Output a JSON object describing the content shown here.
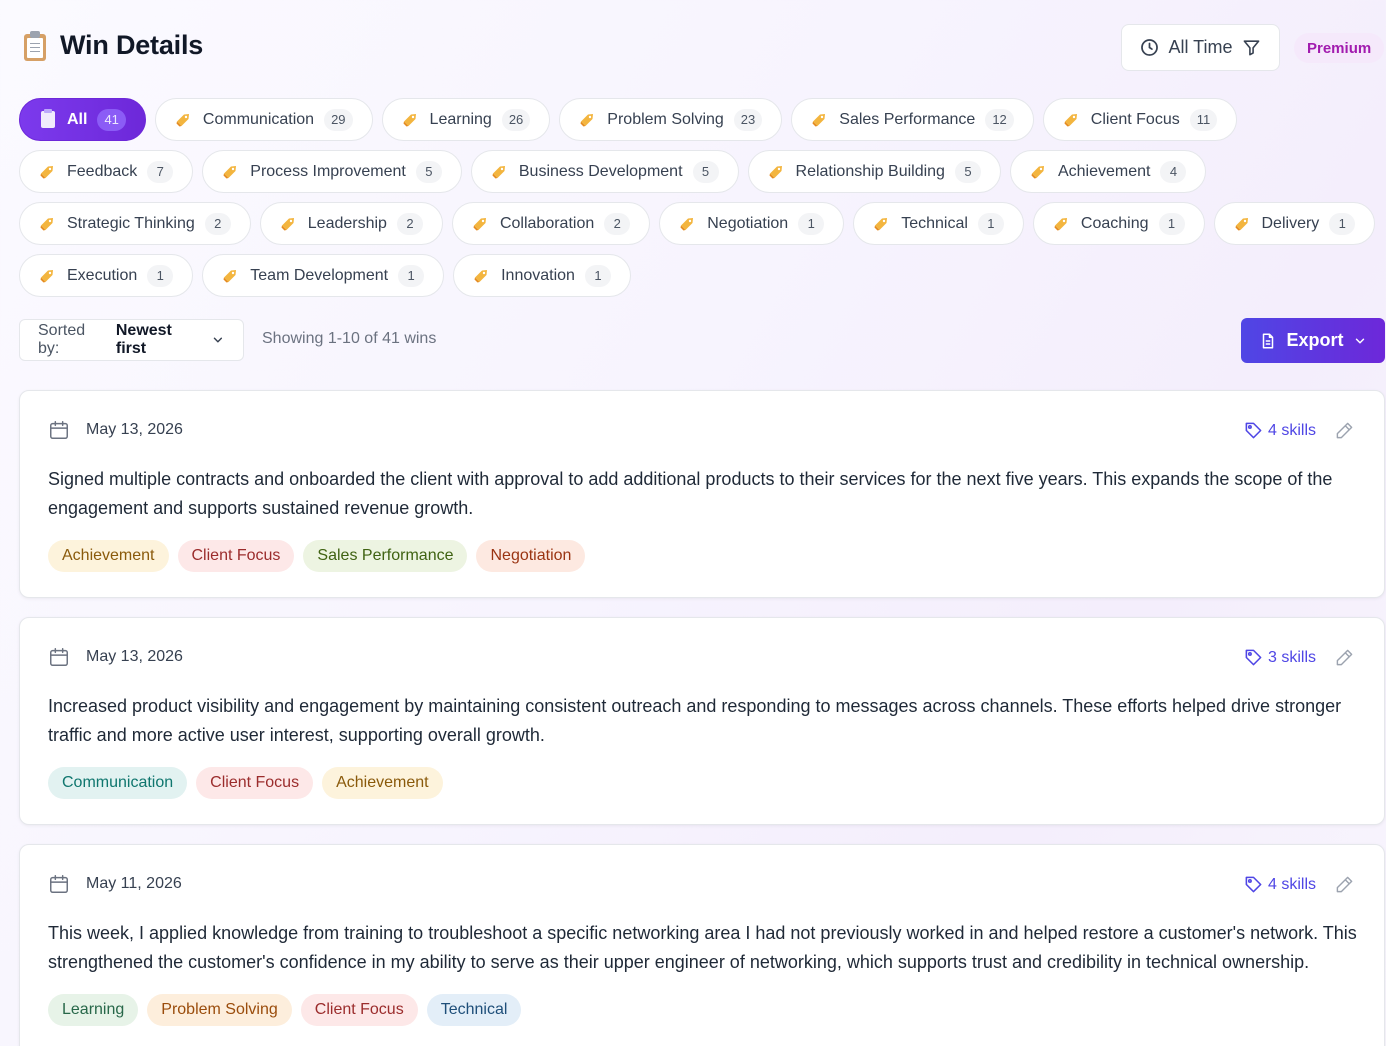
{
  "header": {
    "title": "Win Details",
    "time_filter": "All Time",
    "premium_badge": "Premium"
  },
  "categories": [
    {
      "label": "All",
      "count": "41",
      "active": true
    },
    {
      "label": "Communication",
      "count": "29"
    },
    {
      "label": "Learning",
      "count": "26"
    },
    {
      "label": "Problem Solving",
      "count": "23"
    },
    {
      "label": "Sales Performance",
      "count": "12"
    },
    {
      "label": "Client Focus",
      "count": "11"
    },
    {
      "label": "Feedback",
      "count": "7"
    },
    {
      "label": "Process Improvement",
      "count": "5"
    },
    {
      "label": "Business Development",
      "count": "5"
    },
    {
      "label": "Relationship Building",
      "count": "5"
    },
    {
      "label": "Achievement",
      "count": "4"
    },
    {
      "label": "Strategic Thinking",
      "count": "2"
    },
    {
      "label": "Leadership",
      "count": "2"
    },
    {
      "label": "Collaboration",
      "count": "2"
    },
    {
      "label": "Negotiation",
      "count": "1"
    },
    {
      "label": "Technical",
      "count": "1"
    },
    {
      "label": "Coaching",
      "count": "1"
    },
    {
      "label": "Delivery",
      "count": "1"
    },
    {
      "label": "Execution",
      "count": "1"
    },
    {
      "label": "Team Development",
      "count": "1"
    },
    {
      "label": "Innovation",
      "count": "1"
    }
  ],
  "toolbar": {
    "sort_prefix": "Sorted by:",
    "sort_value": "Newest first",
    "showing": "Showing 1-10 of 41 wins",
    "export_label": "Export"
  },
  "colors": {
    "accent": "#6d28d9",
    "export_start": "#4f46e5",
    "premium_text": "#a21caf"
  },
  "tag_styles": {
    "Achievement": {
      "bg": "#fdf3dc",
      "fg": "#8a5a0b"
    },
    "Client Focus": {
      "bg": "#fde8e8",
      "fg": "#9b2c2c"
    },
    "Sales Performance": {
      "bg": "#edf4e2",
      "fg": "#3f6212"
    },
    "Negotiation": {
      "bg": "#fde9e1",
      "fg": "#9a3412"
    },
    "Communication": {
      "bg": "#e2f2f1",
      "fg": "#0f766e"
    },
    "Learning": {
      "bg": "#e7f3e8",
      "fg": "#276749"
    },
    "Problem Solving": {
      "bg": "#fdeedc",
      "fg": "#9a4c0b"
    },
    "Technical": {
      "bg": "#e3eef8",
      "fg": "#1e4e79"
    }
  },
  "wins": [
    {
      "date": "May 13, 2026",
      "skills": "4 skills",
      "description": "Signed multiple contracts and onboarded the client with approval to add additional products to their services for the next five years. This expands the scope of the engagement and supports sustained revenue growth.",
      "tags": [
        "Achievement",
        "Client Focus",
        "Sales Performance",
        "Negotiation"
      ]
    },
    {
      "date": "May 13, 2026",
      "skills": "3 skills",
      "description": "Increased product visibility and engagement by maintaining consistent outreach and responding to messages across channels. These efforts helped drive stronger traffic and more active user interest, supporting overall growth.",
      "tags": [
        "Communication",
        "Client Focus",
        "Achievement"
      ]
    },
    {
      "date": "May 11, 2026",
      "skills": "4 skills",
      "description": "This week, I applied knowledge from training to troubleshoot a specific networking area I had not previously worked in and helped restore a customer's network. This strengthened the customer's confidence in my ability to serve as their upper engineer of networking, which supports trust and credibility in technical ownership.",
      "tags": [
        "Learning",
        "Problem Solving",
        "Client Focus",
        "Technical"
      ]
    }
  ]
}
